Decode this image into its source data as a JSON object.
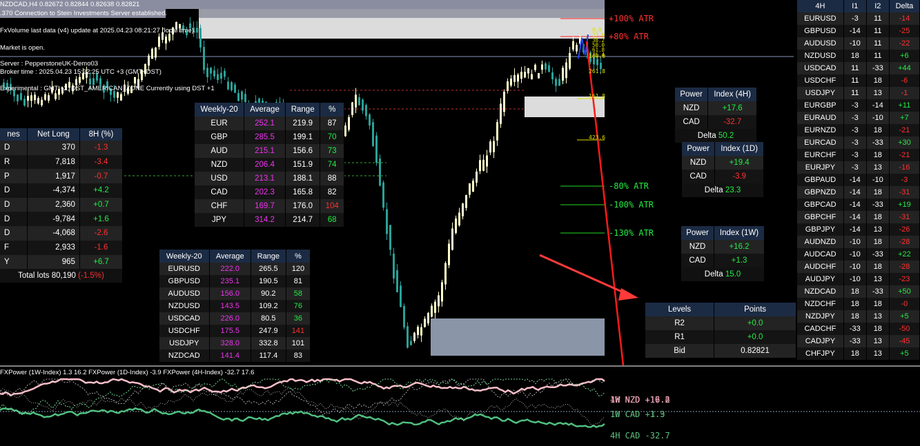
{
  "chart_header": {
    "title": "NZDCAD,H4  0.82672 0.82844 0.82638 0.82821",
    "connection": ".370 Connection to Stein Investments Server established.",
    "fxvolume": "FxVolume last data (v4) update at 2025.04.23 08:21:27 (local time).",
    "market": "Market is open.",
    "server": "Server : PepperstoneUK-Demo03",
    "broker_time": "Broker time : 2025.04.23 15:22:25 UTC +3 (GMT+DST)",
    "experimental": "Experimental : GMT +2, DST_AMERICAN_ZONE Currently using DST +1"
  },
  "atr_levels": {
    "p100": "+100% ATR",
    "p80": "+80% ATR",
    "m80": "-80% ATR",
    "m100": "-100% ATR",
    "m130": "-130% ATR"
  },
  "fib_labels": [
    "0.0",
    "23.6",
    "38.2",
    "50.0",
    "61.8",
    "76.4",
    "100.0",
    "161.8",
    "261.8",
    "423.6"
  ],
  "net_long": {
    "headers": [
      "nes",
      "Net Long",
      "8H (%)"
    ],
    "rows": [
      [
        "D",
        "370",
        "-1.3"
      ],
      [
        "R",
        "7,818",
        "-3.4"
      ],
      [
        "P",
        "1,917",
        "-0.7"
      ],
      [
        "D",
        "-4,374",
        "+4.2"
      ],
      [
        "D",
        "2,360",
        "+0.7"
      ],
      [
        "D",
        "-9,784",
        "+1.6"
      ],
      [
        "D",
        "-4,068",
        "-2.6"
      ],
      [
        "F",
        "2,933",
        "-1.6"
      ],
      [
        "Y",
        "965",
        "+6.7"
      ]
    ],
    "total_label": "Total lots 80,190",
    "total_change": "(-1.5%)"
  },
  "weekly_ccy": {
    "headers": [
      "Weekly-20",
      "Average",
      "Range",
      "%"
    ],
    "rows": [
      [
        "EUR",
        "252.1",
        "219.9",
        "87"
      ],
      [
        "GBP",
        "285.5",
        "199.1",
        "70"
      ],
      [
        "AUD",
        "215.1",
        "156.6",
        "73"
      ],
      [
        "NZD",
        "206.4",
        "151.9",
        "74"
      ],
      [
        "USD",
        "213.1",
        "188.1",
        "88"
      ],
      [
        "CAD",
        "202.3",
        "165.8",
        "82"
      ],
      [
        "CHF",
        "169.7",
        "176.0",
        "104"
      ],
      [
        "JPY",
        "314.2",
        "214.7",
        "68"
      ]
    ]
  },
  "weekly_pairs": {
    "headers": [
      "Weekly-20",
      "Average",
      "Range",
      "%"
    ],
    "rows": [
      [
        "EURUSD",
        "222.0",
        "265.5",
        "120"
      ],
      [
        "GBPUSD",
        "235.1",
        "190.5",
        "81"
      ],
      [
        "AUDUSD",
        "156.0",
        "90.2",
        "58"
      ],
      [
        "NZDUSD",
        "143.5",
        "109.2",
        "76"
      ],
      [
        "USDCAD",
        "226.0",
        "80.5",
        "36"
      ],
      [
        "USDCHF",
        "175.5",
        "247.9",
        "141"
      ],
      [
        "USDJPY",
        "328.0",
        "332.8",
        "101"
      ],
      [
        "NZDCAD",
        "141.4",
        "117.4",
        "83"
      ]
    ]
  },
  "power_4h": {
    "headers": [
      "Power",
      "Index (4H)"
    ],
    "rows": [
      [
        "NZD",
        "+17.6"
      ],
      [
        "CAD",
        "-32.7"
      ]
    ],
    "delta_label": "Delta",
    "delta_value": "50.2"
  },
  "power_1d": {
    "headers": [
      "Power",
      "Index (1D)"
    ],
    "rows": [
      [
        "NZD",
        "+19.4"
      ],
      [
        "CAD",
        "-3.9"
      ]
    ],
    "delta_label": "Delta",
    "delta_value": "23.3"
  },
  "power_1w": {
    "headers": [
      "Power",
      "Index (1W)"
    ],
    "rows": [
      [
        "NZD",
        "+16.2"
      ],
      [
        "CAD",
        "+1.3"
      ]
    ],
    "delta_label": "Delta",
    "delta_value": "15.0"
  },
  "levels": {
    "headers": [
      "Levels",
      "Points"
    ],
    "rows": [
      [
        "R2",
        "+0.0"
      ],
      [
        "R1",
        "+0.0"
      ],
      [
        "Bid",
        "0.82821"
      ]
    ]
  },
  "fourh_table": {
    "headers": [
      "4H",
      "I1",
      "I2",
      "Delta"
    ],
    "rows": [
      [
        "EURUSD",
        "-3",
        "11",
        "-14"
      ],
      [
        "GBPUSD",
        "-14",
        "11",
        "-25"
      ],
      [
        "AUDUSD",
        "-10",
        "11",
        "-22"
      ],
      [
        "NZDUSD",
        "18",
        "11",
        "+6"
      ],
      [
        "USDCAD",
        "11",
        "-33",
        "+44"
      ],
      [
        "USDCHF",
        "11",
        "18",
        "-6"
      ],
      [
        "USDJPY",
        "11",
        "13",
        "-1"
      ],
      [
        "EURGBP",
        "-3",
        "-14",
        "+11"
      ],
      [
        "EURAUD",
        "-3",
        "-10",
        "+7"
      ],
      [
        "EURNZD",
        "-3",
        "18",
        "-21"
      ],
      [
        "EURCAD",
        "-3",
        "-33",
        "+30"
      ],
      [
        "EURCHF",
        "-3",
        "18",
        "-21"
      ],
      [
        "EURJPY",
        "-3",
        "13",
        "-16"
      ],
      [
        "GBPAUD",
        "-14",
        "-10",
        "-3"
      ],
      [
        "GBPNZD",
        "-14",
        "18",
        "-31"
      ],
      [
        "GBPCAD",
        "-14",
        "-33",
        "+19"
      ],
      [
        "GBPCHF",
        "-14",
        "18",
        "-31"
      ],
      [
        "GBPJPY",
        "-14",
        "13",
        "-26"
      ],
      [
        "AUDNZD",
        "-10",
        "18",
        "-28"
      ],
      [
        "AUDCAD",
        "-10",
        "-33",
        "+22"
      ],
      [
        "AUDCHF",
        "-10",
        "18",
        "-28"
      ],
      [
        "AUDJPY",
        "-10",
        "13",
        "-23"
      ],
      [
        "NZDCAD",
        "18",
        "-33",
        "+50"
      ],
      [
        "NZDCHF",
        "18",
        "18",
        "-0"
      ],
      [
        "NZDJPY",
        "18",
        "13",
        "+5"
      ],
      [
        "CADCHF",
        "-33",
        "18",
        "-50"
      ],
      [
        "CADJPY",
        "-33",
        "13",
        "-45"
      ],
      [
        "CHFJPY",
        "18",
        "13",
        "+5"
      ]
    ]
  },
  "oscillator": {
    "title": "FXPower (1W-Index) 1.3 16.2  FXPower (1D-Index) -3.9  FXPower (4H-Index) -32.7 17.6",
    "labels": [
      {
        "text": "1W NZD +16.2",
        "color": "#ffc0cb"
      },
      {
        "text": "4H NZD +17.6",
        "color": "#ffb6c1"
      },
      {
        "text": "1D NZD +19.4",
        "color": "#ff9ec0"
      },
      {
        "text": "1W CAD +1.3",
        "color": "#5fbf7f"
      },
      {
        "text": "1D CAD -3.9",
        "color": "#5fbf7f"
      },
      {
        "text": "4H CAD -32.7",
        "color": "#5fbf7f"
      }
    ]
  },
  "colors": {
    "bull": "#ffffcc",
    "bear": "#2aa198",
    "header_bg": "#1c2b44",
    "positive": "#22ee44",
    "negative": "#ff3030",
    "average": "#ee33ee"
  }
}
